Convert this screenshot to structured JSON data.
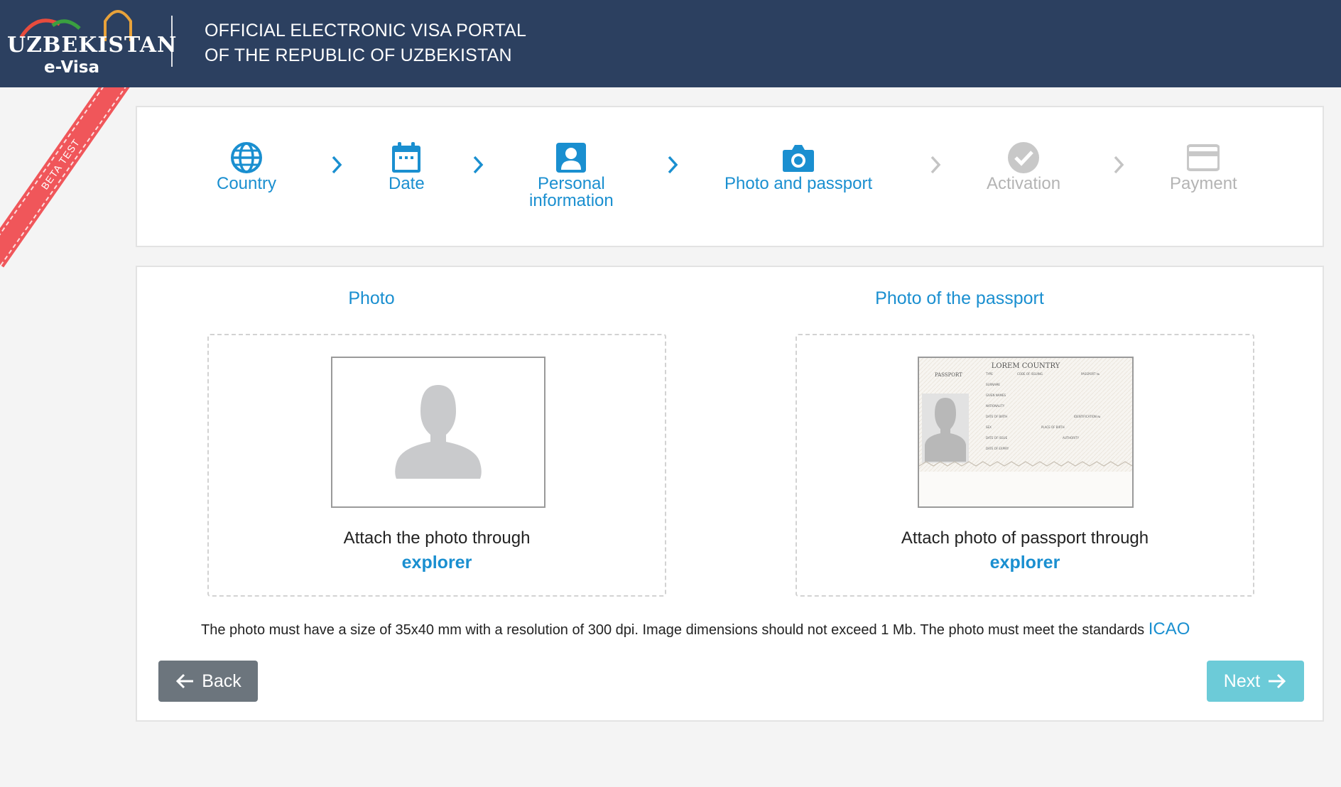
{
  "header": {
    "logo_text": "UZBEKISTAN",
    "logo_sub": "e-Visa",
    "title_line1": "OFFICIAL ELECTRONIC VISA PORTAL",
    "title_line2": "OF THE REPUBLIC OF UZBEKISTAN"
  },
  "ribbon": {
    "label": "BETA TEST"
  },
  "steps": [
    {
      "label": "Country",
      "icon": "globe-icon",
      "state": "done"
    },
    {
      "label": "Date",
      "icon": "calendar-icon",
      "state": "done"
    },
    {
      "label_line1": "Personal",
      "label_line2": "information",
      "icon": "user-icon",
      "state": "done"
    },
    {
      "label": "Photo and passport",
      "icon": "camera-icon",
      "state": "current"
    },
    {
      "label": "Activation",
      "icon": "check-circle-icon",
      "state": "pending"
    },
    {
      "label": "Payment",
      "icon": "credit-card-icon",
      "state": "pending"
    }
  ],
  "photo_section": {
    "title": "Photo",
    "attach_text": "Attach the photo through",
    "link": "explorer"
  },
  "passport_section": {
    "title": "Photo of the passport",
    "attach_text": "Attach photo of passport through",
    "link": "explorer",
    "sample": {
      "country": "LOREM COUNTRY",
      "doc": "PASSPORT",
      "fields": [
        "TYPE",
        "CODE OF ISSUING",
        "PASSPORT №",
        "SURNAME",
        "GIVEN NAMES",
        "NATIONALITY",
        "DATE OF BIRTH",
        "IDENTIFICATION №",
        "SEX",
        "PLACE OF BIRTH",
        "DATE OF ISSUE",
        "AUTHORITY",
        "DATE OF EXPIRY"
      ]
    }
  },
  "note": {
    "text": "The photo must have a size of 35x40 mm with a resolution of 300 dpi. Image dimensions should not exceed 1 Mb. The photo must meet the standards",
    "link": "ICAO"
  },
  "buttons": {
    "back": "Back",
    "next": "Next"
  },
  "colors": {
    "header": "#2c4060",
    "accent": "#1a8fd0",
    "inactive": "#b4b4b4",
    "ribbon": "#f0565a",
    "back_btn": "#6c757d",
    "next_btn": "#6ccbd8"
  }
}
